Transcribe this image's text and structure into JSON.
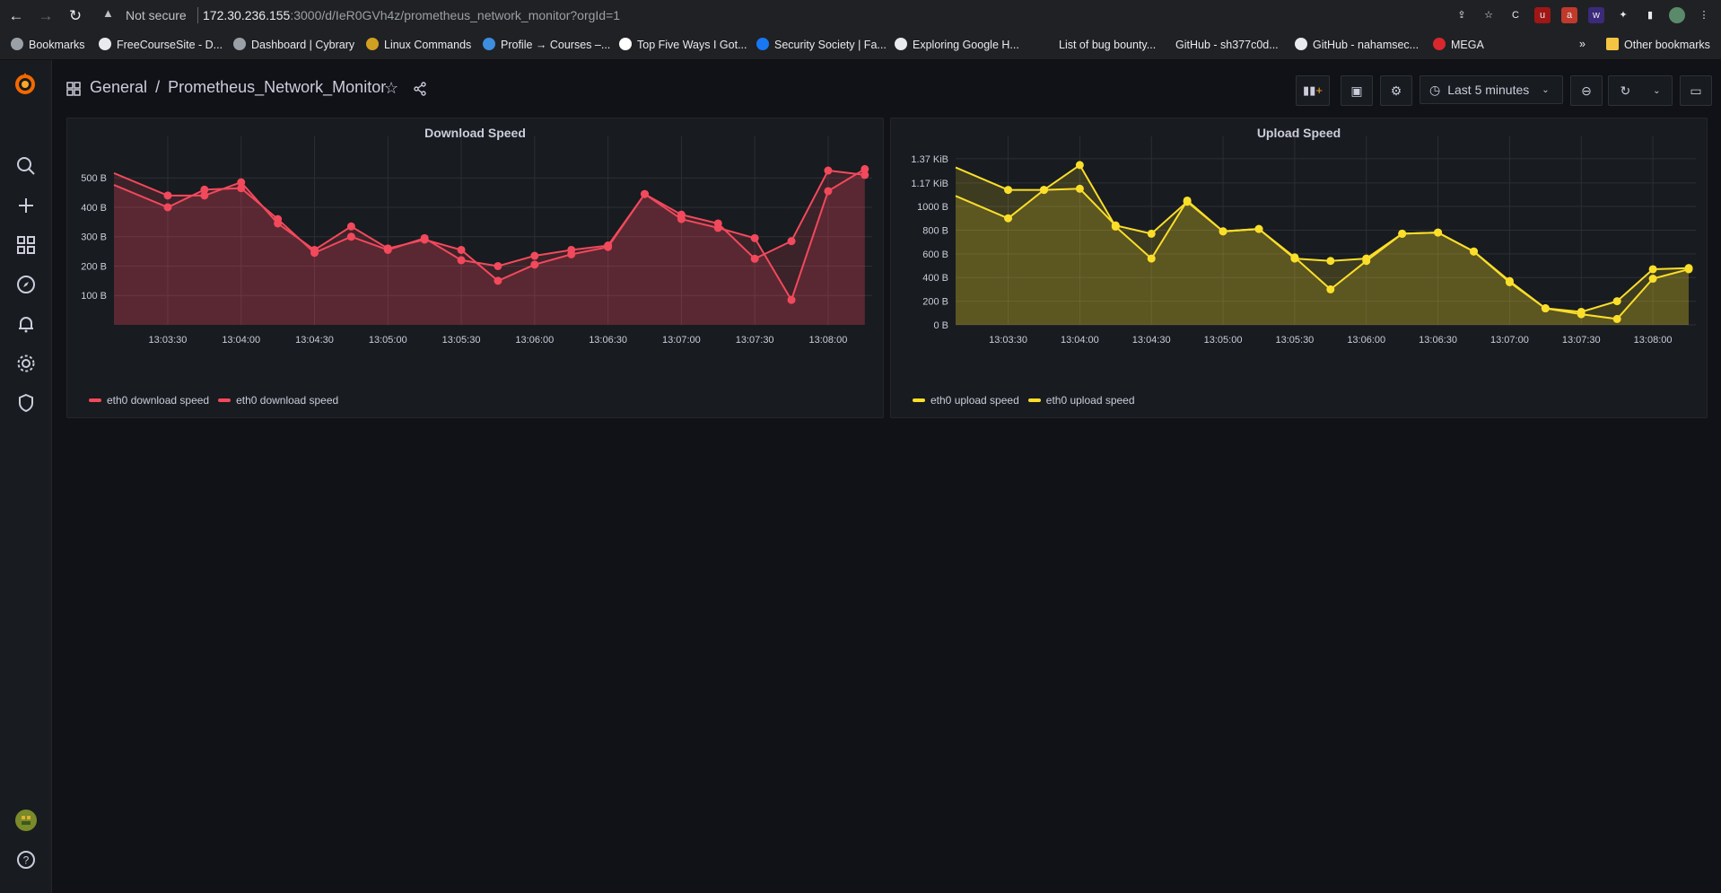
{
  "browser": {
    "security_label": "Not secure",
    "url_host": "172.30.236.155",
    "url_rest": ":3000/d/IeR0GVh4z/prometheus_network_monitor?orgId=1",
    "bookmarks": [
      {
        "label": "Bookmarks",
        "icon": "star-icon",
        "color": "#9aa0a6"
      },
      {
        "label": "FreeCourseSite - D...",
        "icon": "wordpress-icon",
        "color": "#e8eaed"
      },
      {
        "label": "Dashboard | Cybrary",
        "icon": "cybrary-icon",
        "color": "#9aa0a6"
      },
      {
        "label": "Linux Commands",
        "icon": "linux-icon",
        "color": "#d0a020"
      },
      {
        "label": "Profile → Courses –...",
        "icon": "udemy-icon",
        "color": "#3d8de0"
      },
      {
        "label": "Top Five Ways I Got...",
        "icon": "medium-icon",
        "color": "#ffffff"
      },
      {
        "label": "Security Society | Fa...",
        "icon": "facebook-icon",
        "color": "#1877f2"
      },
      {
        "label": "Exploring Google H...",
        "icon": "st-icon",
        "color": "#e8eaed"
      },
      {
        "label": "List of bug bounty...",
        "icon": "page-icon",
        "color": "#202124"
      },
      {
        "label": "GitHub - sh377c0d...",
        "icon": "github-icon",
        "color": "#202124"
      },
      {
        "label": "GitHub - nahamsec...",
        "icon": "github-icon",
        "color": "#e8eaed"
      },
      {
        "label": "MEGA",
        "icon": "mega-icon",
        "color": "#d9272e"
      }
    ],
    "more_label": "»",
    "other_bookmarks": "Other bookmarks"
  },
  "dashboard": {
    "folder": "General",
    "separator": "/",
    "name": "Prometheus_Network_Monitor",
    "time_range": "Last 5 minutes"
  },
  "panels": [
    {
      "title": "Download Speed",
      "legend": [
        "eth0 download speed",
        "eth0 download speed"
      ],
      "color": "#f2495c"
    },
    {
      "title": "Upload Speed",
      "legend": [
        "eth0 upload speed",
        "eth0 upload speed"
      ],
      "color": "#fade2a"
    }
  ],
  "chart_data": [
    {
      "type": "area",
      "title": "Download Speed",
      "x_ticks": [
        "13:03:30",
        "13:04:00",
        "13:04:30",
        "13:05:00",
        "13:05:30",
        "13:06:00",
        "13:06:30",
        "13:07:00",
        "13:07:30",
        "13:08:00"
      ],
      "y_ticks": [
        "100 B",
        "200 B",
        "300 B",
        "400 B",
        "500 B"
      ],
      "ylim": [
        0,
        580
      ],
      "x": [
        "13:03:30",
        "13:03:45",
        "13:04:00",
        "13:04:15",
        "13:04:30",
        "13:04:45",
        "13:05:00",
        "13:05:15",
        "13:05:30",
        "13:05:45",
        "13:06:00",
        "13:06:15",
        "13:06:30",
        "13:06:45",
        "13:07:00",
        "13:07:15",
        "13:07:30",
        "13:07:45",
        "13:08:00",
        "13:08:15"
      ],
      "series": [
        {
          "name": "eth0 download speed",
          "values": [
            400,
            460,
            465,
            360,
            245,
            300,
            255,
            295,
            220,
            200,
            235,
            255,
            270,
            445,
            360,
            330,
            295,
            85,
            455,
            530
          ]
        },
        {
          "name": "eth0 download speed",
          "values": [
            440,
            440,
            485,
            345,
            255,
            335,
            260,
            290,
            255,
            150,
            205,
            240,
            265,
            445,
            375,
            345,
            225,
            285,
            525,
            510
          ]
        }
      ]
    },
    {
      "type": "area",
      "title": "Upload Speed",
      "x_ticks": [
        "13:03:30",
        "13:04:00",
        "13:04:30",
        "13:05:00",
        "13:05:30",
        "13:06:00",
        "13:06:30",
        "13:07:00",
        "13:07:30",
        "13:08:00"
      ],
      "y_ticks": [
        "0 B",
        "200 B",
        "400 B",
        "600 B",
        "800 B",
        "1000 B",
        "1.17 KiB",
        "1.37 KiB"
      ],
      "ylim": [
        0,
        1440
      ],
      "x": [
        "13:03:30",
        "13:03:45",
        "13:04:00",
        "13:04:15",
        "13:04:30",
        "13:04:45",
        "13:05:00",
        "13:05:15",
        "13:05:30",
        "13:05:45",
        "13:06:00",
        "13:06:15",
        "13:06:30",
        "13:06:45",
        "13:07:00",
        "13:07:15",
        "13:07:30",
        "13:07:45",
        "13:08:00",
        "13:08:15"
      ],
      "series": [
        {
          "name": "eth0 upload speed",
          "values": [
            1140,
            1140,
            1150,
            840,
            770,
            1040,
            790,
            810,
            560,
            540,
            560,
            770,
            780,
            620,
            370,
            140,
            110,
            200,
            470,
            480
          ]
        },
        {
          "name": "eth0 upload speed",
          "values": [
            900,
            1140,
            1350,
            830,
            560,
            1050,
            790,
            810,
            570,
            300,
            540,
            770,
            780,
            620,
            360,
            140,
            90,
            50,
            390,
            470
          ]
        }
      ]
    }
  ]
}
